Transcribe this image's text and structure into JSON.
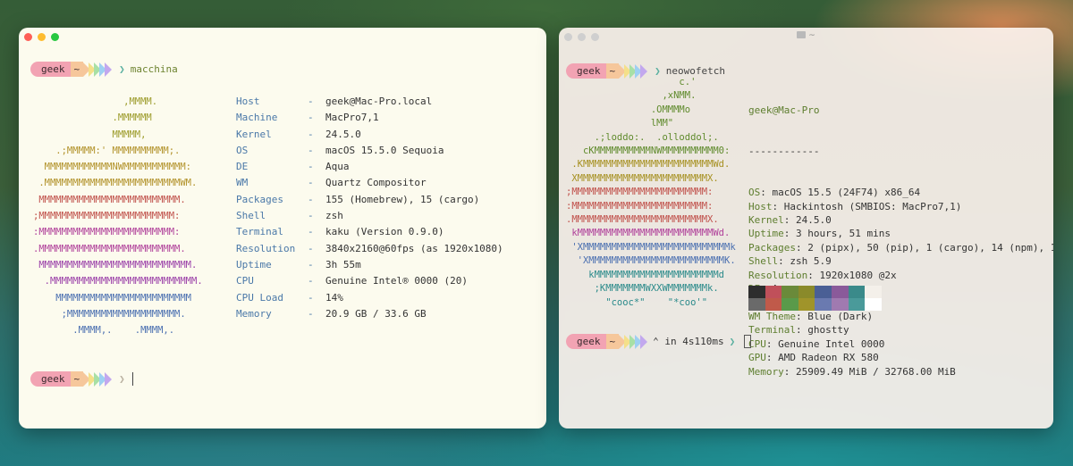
{
  "prompt": {
    "user": "geek",
    "path": "~",
    "symbol": "❯"
  },
  "left_window": {
    "command": "macchina",
    "ascii": [
      {
        "text": "                ,MMMM.",
        "color": "#9c9b2a"
      },
      {
        "text": "              .MMMMMM",
        "color": "#9c9b2a"
      },
      {
        "text": "              MMMMM,",
        "color": "#9c9b2a"
      },
      {
        "text": "    .;MMMMM:' MMMMMMMMMM;.",
        "color": "#b2922a"
      },
      {
        "text": "  MMMMMMMMMMMMNWMMMMMMMMMMM:",
        "color": "#b2922a"
      },
      {
        "text": " .MMMMMMMMMMMMMMMMMMMMMMMMWM.",
        "color": "#b2922a"
      },
      {
        "text": " MMMMMMMMMMMMMMMMMMMMMMMMM.",
        "color": "#c0504a"
      },
      {
        "text": ";MMMMMMMMMMMMMMMMMMMMMMMM:",
        "color": "#c0504a"
      },
      {
        "text": ":MMMMMMMMMMMMMMMMMMMMMMMM:",
        "color": "#b0409a"
      },
      {
        "text": ".MMMMMMMMMMMMMMMMMMMMMMMMM.",
        "color": "#b0409a"
      },
      {
        "text": " MMMMMMMMMMMMMMMMMMMMMMMMMMM.",
        "color": "#9a3fa8"
      },
      {
        "text": "  .MMMMMMMMMMMMMMMMMMMMMMMMMM.",
        "color": "#9a3fa8"
      },
      {
        "text": "    MMMMMMMMMMMMMMMMMMMMMMMM",
        "color": "#4a6fb0"
      },
      {
        "text": "     ;MMMMMMMMMMMMMMMMMMMM.",
        "color": "#4a6fb0"
      },
      {
        "text": "       .MMMM,.    .MMMM,.",
        "color": "#4a6fb0"
      }
    ],
    "info": [
      {
        "key": "Host",
        "value": "geek@Mac-Pro.local"
      },
      {
        "key": "Machine",
        "value": "MacPro7,1"
      },
      {
        "key": "Kernel",
        "value": "24.5.0"
      },
      {
        "key": "OS",
        "value": "macOS 15.5.0 Sequoia"
      },
      {
        "key": "DE",
        "value": "Aqua"
      },
      {
        "key": "WM",
        "value": "Quartz Compositor"
      },
      {
        "key": "Packages",
        "value": "155 (Homebrew), 15 (cargo)"
      },
      {
        "key": "Shell",
        "value": "zsh"
      },
      {
        "key": "Terminal",
        "value": "kaku (Version 0.9.0)"
      },
      {
        "key": "Resolution",
        "value": "3840x2160@60fps (as 1920x1080)"
      },
      {
        "key": "Uptime",
        "value": "3h 55m"
      },
      {
        "key": "CPU",
        "value": "Genuine Intel® 0000 (20)"
      },
      {
        "key": "CPU Load",
        "value": "14%"
      },
      {
        "key": "Memory",
        "value": "20.9 GB / 33.6 GB"
      }
    ],
    "separator": "-"
  },
  "right_window": {
    "title": "~",
    "command": "neowofetch",
    "ascii": [
      {
        "text": "                    c.'",
        "color": "#5f8a2c"
      },
      {
        "text": "                 ,xNMM.",
        "color": "#5f8a2c"
      },
      {
        "text": "               .OMMMMo",
        "color": "#5f8a2c"
      },
      {
        "text": "               lMM\"",
        "color": "#5f8a2c"
      },
      {
        "text": "     .;loddo:.  .olloddol;.",
        "color": "#5f8a2c"
      },
      {
        "text": "   cKMMMMMMMMMMNWMMMMMMMMMM0:",
        "color": "#5f8a2c"
      },
      {
        "text": " .KMMMMMMMMMMMMMMMMMMMMMMMWd.",
        "color": "#a69020"
      },
      {
        "text": " XMMMMMMMMMMMMMMMMMMMMMMMX.",
        "color": "#a69020"
      },
      {
        "text": ";MMMMMMMMMMMMMMMMMMMMMMMM:",
        "color": "#c0504a"
      },
      {
        "text": ":MMMMMMMMMMMMMMMMMMMMMMMM:",
        "color": "#c0504a"
      },
      {
        "text": ".MMMMMMMMMMMMMMMMMMMMMMMMX.",
        "color": "#c0504a"
      },
      {
        "text": " kMMMMMMMMMMMMMMMMMMMMMMMMWd.",
        "color": "#b0409a"
      },
      {
        "text": " 'XMMMMMMMMMMMMMMMMMMMMMMMMMMk",
        "color": "#4a6fb0"
      },
      {
        "text": "  'XMMMMMMMMMMMMMMMMMMMMMMMMK.",
        "color": "#4a6fb0"
      },
      {
        "text": "    kMMMMMMMMMMMMMMMMMMMMMMd",
        "color": "#2a8a8a"
      },
      {
        "text": "     ;KMMMMMMMWXXWMMMMMMMk.",
        "color": "#2a8a8a"
      },
      {
        "text": "       \"cooc*\"    \"*coo'\"",
        "color": "#2a8a8a"
      }
    ],
    "header": "geek@Mac-Pro",
    "rule": "------------",
    "info": [
      {
        "key": "OS",
        "value": "macOS 15.5 (24F74) x86_64"
      },
      {
        "key": "Host",
        "value": "Hackintosh (SMBIOS: MacPro7,1)"
      },
      {
        "key": "Kernel",
        "value": "24.5.0"
      },
      {
        "key": "Uptime",
        "value": "3 hours, 51 mins"
      },
      {
        "key": "Packages",
        "value": "2 (pipx), 50 (pip), 1 (cargo), 14 (npm), 1"
      },
      {
        "key": "Shell",
        "value": "zsh 5.9"
      },
      {
        "key": "Resolution",
        "value": "1920x1080 @2x"
      },
      {
        "key": "DE",
        "value": "Aqua"
      },
      {
        "key": "WM",
        "value": "Quartz Compositor"
      },
      {
        "key": "WM Theme",
        "value": "Blue (Dark)"
      },
      {
        "key": "Terminal",
        "value": "ghostty"
      },
      {
        "key": "CPU",
        "value": "Genuine Intel 0000"
      },
      {
        "key": "GPU",
        "value": "AMD Radeon RX 580"
      },
      {
        "key": "Memory",
        "value": "25909.49 MiB / 32768.00 MiB"
      }
    ],
    "palette_top": [
      "#2e2e2e",
      "#c0505a",
      "#6a8a3a",
      "#8a8a2a",
      "#4a5f95",
      "#8a5a9a",
      "#3a8a8a",
      "#f4f0ea"
    ],
    "palette_bottom": [
      "#6a6a6a",
      "#c05a4a",
      "#5a9a4a",
      "#a0942a",
      "#6a7ab0",
      "#a07ab0",
      "#4a9a9a",
      "#ffffff"
    ],
    "timing": "in 4s110ms"
  }
}
